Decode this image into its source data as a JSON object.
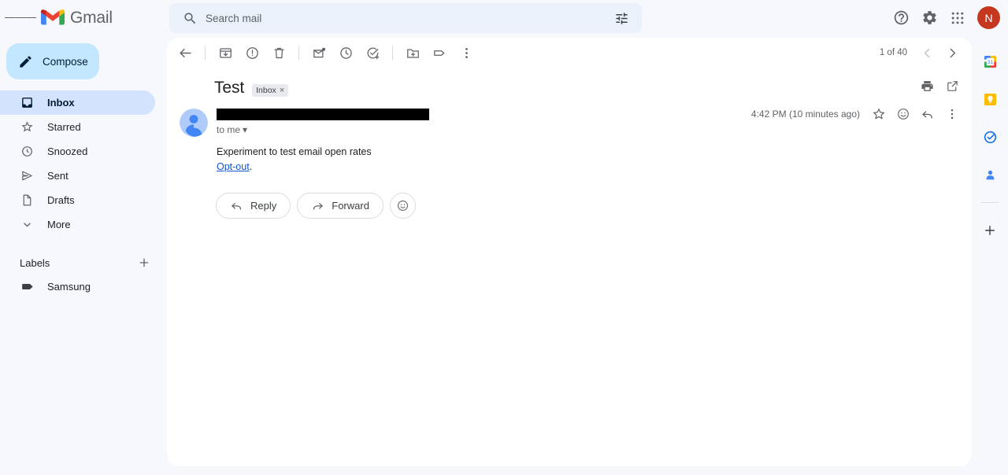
{
  "app": {
    "brand": "Gmail",
    "accent_blue": "#c2e7ff",
    "avatar_initial": "N",
    "avatar_color": "#c5371f"
  },
  "search": {
    "placeholder": "Search mail",
    "value": "",
    "icon": "search-icon",
    "options_icon": "search-options-icon"
  },
  "topbar": {
    "menu_icon": "hamburger-menu-icon",
    "support_icon": "support-icon",
    "settings_icon": "gear-icon",
    "apps_icon": "google-apps-grid-icon"
  },
  "sidebar": {
    "compose_label": "Compose",
    "compose_icon": "pencil-icon",
    "items": [
      {
        "label": "Inbox",
        "icon": "inbox-icon",
        "active": true
      },
      {
        "label": "Starred",
        "icon": "star-icon",
        "active": false
      },
      {
        "label": "Snoozed",
        "icon": "clock-icon",
        "active": false
      },
      {
        "label": "Sent",
        "icon": "send-icon",
        "active": false
      },
      {
        "label": "Drafts",
        "icon": "draft-icon",
        "active": false
      },
      {
        "label": "More",
        "icon": "chevron-down-icon",
        "active": false
      }
    ],
    "labels_header": "Labels",
    "labels_add_icon": "plus-icon",
    "labels": [
      {
        "label": "Samsung",
        "icon": "label-tag-icon"
      }
    ]
  },
  "toolbar": {
    "back_icon": "back-arrow-icon",
    "archive_icon": "archive-icon",
    "spam_icon": "report-spam-icon",
    "delete_icon": "trash-icon",
    "unread_icon": "mark-unread-icon",
    "snooze_icon": "snooze-clock-icon",
    "task_icon": "add-to-tasks-icon",
    "move_icon": "move-to-icon",
    "labels_icon": "labels-icon",
    "more_icon": "more-vertical-icon",
    "pager_text": "1 of 40",
    "prev_icon": "chevron-left-icon",
    "next_icon": "chevron-right-icon"
  },
  "message": {
    "subject": "Test",
    "chip_label": "Inbox",
    "chip_close": "×",
    "print_icon": "print-icon",
    "popout_icon": "open-in-new-window-icon",
    "sender_redacted": true,
    "recipient": "to me",
    "recipient_caret": "▾",
    "timestamp": "4:42 PM (10 minutes ago)",
    "star_icon": "star-outline-icon",
    "emoji_icon": "add-reaction-icon",
    "reply_icon": "reply-arrow-icon",
    "more_icon": "more-vertical-icon",
    "body_line1": "Experiment to test email open rates",
    "body_link": "Opt-out",
    "body_link_suffix": ".",
    "reply_label": "Reply",
    "forward_label": "Forward",
    "reply_btn_icon": "reply-icon",
    "forward_btn_icon": "forward-icon",
    "react_btn_icon": "emoji-smiley-icon"
  },
  "sidestrip": {
    "items": [
      {
        "name": "google-calendar-icon"
      },
      {
        "name": "google-keep-icon"
      },
      {
        "name": "google-tasks-icon"
      },
      {
        "name": "google-contacts-icon"
      }
    ],
    "add_icon": "add-addon-icon"
  }
}
